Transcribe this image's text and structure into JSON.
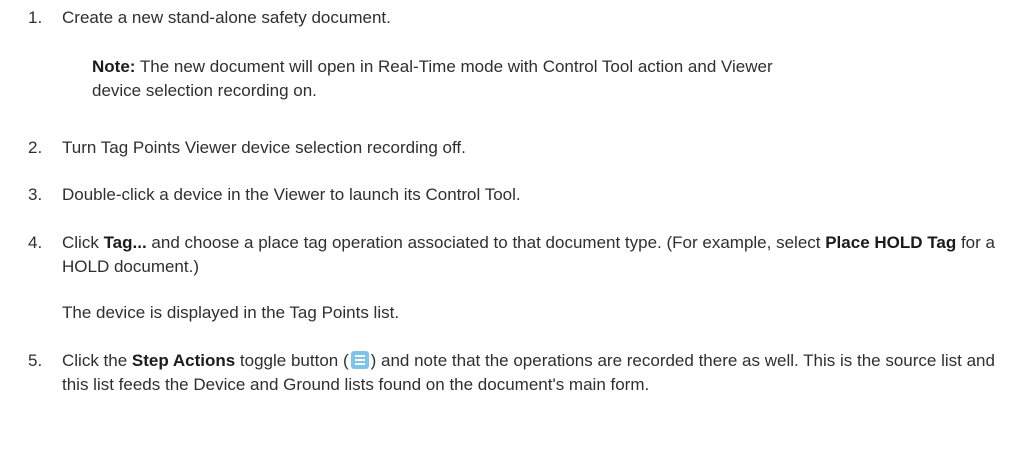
{
  "steps": [
    {
      "num": "1.",
      "text": "Create a new stand-alone safety document."
    },
    {
      "num": "2.",
      "text": "Turn Tag Points Viewer device selection recording off."
    },
    {
      "num": "3.",
      "text": "Double-click a device in the Viewer to launch its Control Tool."
    },
    {
      "num": "4.",
      "pre": "Click ",
      "bold1": "Tag...",
      "mid": " and choose a place tag operation associated to that document type. (For example, select ",
      "bold2": "Place HOLD Tag",
      "post": " for a HOLD document.)",
      "followup": "The device is displayed in the Tag Points list."
    },
    {
      "num": "5.",
      "pre": "Click the ",
      "bold1": "Step Actions",
      "mid": " toggle button (",
      "icon": "step-actions-list-icon",
      "post": ") and note that the operations are recorded there as well. This is the source list and this list feeds the Device and Ground lists found on the document's main form."
    }
  ],
  "note": {
    "label": "Note:",
    "text": " The new document will open in Real-Time mode with Control Tool action and Viewer device selection recording on."
  },
  "colors": {
    "icon": "#7cc4ea",
    "text": "#2f2f2f"
  }
}
